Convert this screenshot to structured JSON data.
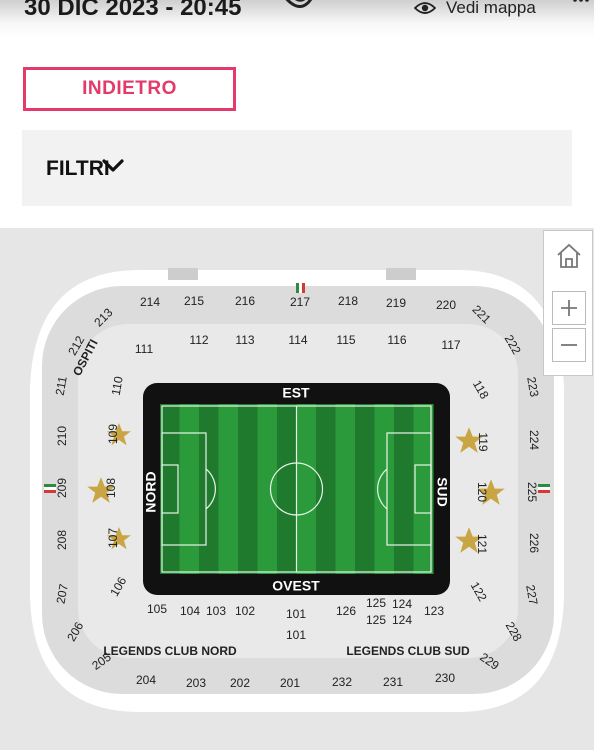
{
  "header": {
    "date_time": "30 DIC 2023 - 20:45",
    "map_view_label": "Vedi mappa"
  },
  "actions": {
    "back_label": "INDIETRO",
    "filters_label": "FILTRI"
  },
  "stadium": {
    "stands": {
      "north": "NORD",
      "south": "SUD",
      "east": "EST",
      "west": "OVEST"
    },
    "labels": {
      "away": "OSPITI",
      "legends_north": "LEGENDS CLUB NORD",
      "legends_south": "LEGENDS CLUB SUD"
    },
    "sections_upper_east": [
      "214",
      "215",
      "216",
      "217",
      "218",
      "219",
      "220"
    ],
    "sections_lower_east": [
      "111",
      "112",
      "113",
      "114",
      "115",
      "116",
      "117"
    ],
    "sections_north_upper": [
      "213",
      "212",
      "211",
      "210",
      "209",
      "208",
      "207",
      "206",
      "205"
    ],
    "sections_north_lower": [
      "110",
      "109",
      "108",
      "107",
      "106"
    ],
    "sections_south_upper": [
      "221",
      "222",
      "223",
      "224",
      "225",
      "226",
      "227",
      "228",
      "229"
    ],
    "sections_south_lower": [
      "118",
      "119",
      "120",
      "121",
      "122"
    ],
    "sections_lower_west": [
      "105",
      "104",
      "103",
      "102",
      "101",
      "126",
      "125",
      "124",
      "123"
    ],
    "sections_west_extra": [
      "101",
      "125",
      "124"
    ],
    "sections_upper_west": [
      "204",
      "203",
      "202",
      "201",
      "232",
      "231",
      "230"
    ]
  },
  "colors": {
    "accent": "#e13a6b",
    "pitch_dark": "#1f7a2e",
    "pitch_light": "#2b9a3a",
    "star_gold": "#c9a544",
    "stand_black": "#111111",
    "seat_gray": "#d3d3d3"
  },
  "icons": {
    "map_view": "eye-icon",
    "filters_toggle": "chevron-down-icon",
    "home": "home-icon",
    "zoom_in": "plus-icon",
    "zoom_out": "minus-icon",
    "more": "more-icon"
  }
}
